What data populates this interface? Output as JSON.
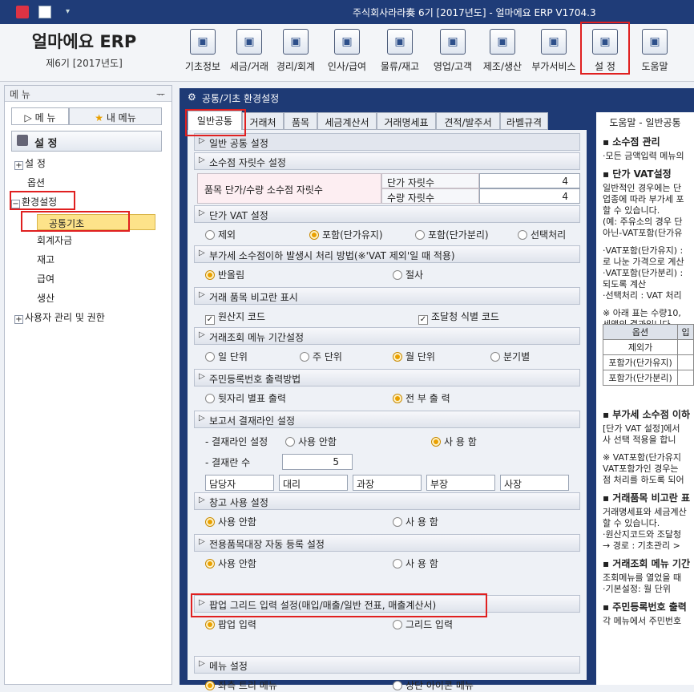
{
  "window": {
    "title": "주식회사라라奏 6기 [2017년도] - 얼마에요 ERP V1704.3"
  },
  "brand": {
    "logo": "얼마에요 ERP",
    "period": "제6기 [2017년도]"
  },
  "toolbar": [
    {
      "label": "기초정보",
      "icon": "doc-icon"
    },
    {
      "label": "세금/거래",
      "icon": "tax-icon"
    },
    {
      "label": "경리/회계",
      "icon": "accounting-icon"
    },
    {
      "label": "인사/급여",
      "icon": "hr-icon"
    },
    {
      "label": "물류/재고",
      "icon": "logistics-icon"
    },
    {
      "label": "영업/고객",
      "icon": "sales-icon"
    },
    {
      "label": "제조/생산",
      "icon": "factory-icon"
    },
    {
      "label": "부가서비스",
      "icon": "addon-icon"
    },
    {
      "label": "설 정",
      "icon": "settings-icon"
    },
    {
      "label": "도움말",
      "icon": "help-icon"
    }
  ],
  "left": {
    "header": "메 뉴",
    "pin": "ᅲ",
    "tab_menu": "메 뉴",
    "tab_my": "내 메뉴",
    "section": "설 정",
    "tree": [
      {
        "label": "설 정",
        "toggle": "+"
      },
      {
        "label": "옵션",
        "toggle": ""
      },
      {
        "label": "환경설정",
        "toggle": "−"
      },
      {
        "label": "공통기초",
        "toggle": ""
      },
      {
        "label": "회계자금",
        "toggle": ""
      },
      {
        "label": "재고",
        "toggle": ""
      },
      {
        "label": "급여",
        "toggle": ""
      },
      {
        "label": "생산",
        "toggle": ""
      },
      {
        "label": "사용자 관리 및 권한",
        "toggle": "+"
      }
    ]
  },
  "main": {
    "title": "공통/기초 환경설정",
    "tabs": [
      "일반공통",
      "거래처",
      "품목",
      "세금계산서",
      "거래명세표",
      "견적/발주서",
      "라벨규격"
    ],
    "help_tab": "도움말 - 일반공통",
    "section_title": "일반 공통 설정"
  },
  "form": {
    "decimal": {
      "title": "소수점 자릿수 설정",
      "label": "품목 단가/수량 소수점 자릿수",
      "unit_label": "단가 자릿수",
      "unit_value": "4",
      "qty_label": "수량 자릿수",
      "qty_value": "4"
    },
    "vat": {
      "title": "단가 VAT 설정",
      "options": [
        "제외",
        "포함(단가유지)",
        "포함(단가분리)",
        "선택처리"
      ],
      "selected": 1
    },
    "round": {
      "title": "부가세 소수점이하 발생시 처리 방법(※'VAT 제외'일 때 적용)",
      "options": [
        "반올림",
        "절사"
      ],
      "selected": 0
    },
    "compare": {
      "title": "거래 품목 비고란 표시",
      "options": [
        "원산지 코드",
        "조달청 식별 코드"
      ]
    },
    "period": {
      "title": "거래조회 메뉴 기간설정",
      "options": [
        "일 단위",
        "주 단위",
        "월 단위",
        "분기별"
      ],
      "selected": 2
    },
    "rrn": {
      "title": "주민등록번호 출력방법",
      "options": [
        "뒷자리 별표 출력",
        "전 부  출 력"
      ],
      "selected": 1
    },
    "approval": {
      "title": "보고서 결재라인 설정",
      "line_label": "-  결재라인 설정",
      "line_options": [
        "사용 안함",
        "사 용 함"
      ],
      "line_selected": 1,
      "count_label": "-  결재란 수",
      "count_value": "5",
      "names": [
        "담당자",
        "대리",
        "과장",
        "부장",
        "사장"
      ]
    },
    "warehouse": {
      "title": "창고 사용 설정",
      "options": [
        "사용 안함",
        "사 용 함"
      ],
      "selected": 0
    },
    "autoreg": {
      "title": "전용품목대장 자동 등록 설정",
      "options": [
        "사용 안함",
        "사 용 함"
      ],
      "selected": 0
    },
    "popup": {
      "title": "팝업 그리드 입력 설정(매입/매출/일반 전표, 매출계산서)",
      "options": [
        "팝업 입력",
        "그리드 입력"
      ],
      "selected": 0
    },
    "menu": {
      "title": "메뉴 설정",
      "options": [
        "좌측 트리 메뉴",
        "상단 아이콘 메뉴"
      ],
      "selected": 0
    }
  },
  "help": {
    "lines": [
      "▪ 소수점 관리",
      "·모든 금액입력 메뉴의",
      "▪ 단가 VAT설정",
      "일반적인 경우에는 단",
      "업종에 따라 부가세 포",
      "할 수 있습니다.",
      "(예: 주유소의 경우 단",
      "아닌-VAT포함(단가유",
      "·VAT포함(단가유지) :",
      "로 나눈 가격으로 계산",
      "·VAT포함(단가분리) :",
      "되도록 계산",
      "·선택처리 : VAT 처리",
      "※ 아래 표는 수량10,",
      "세액의 결과입니다.",
      "▪ 부가세 소수점 이하",
      "[단가 VAT 설정]에서",
      "사 선택 적용을 합니",
      "※ VAT포함(단가유지",
      "VAT포함가인 경우는",
      "점 처리를 하도록 되어",
      "▪ 거래품목 비고란 표",
      "거래명세표와 세금계산",
      "할 수 있습니다.",
      "·원산지코드와 조달청",
      "→ 경로 : 기초관리 >",
      "▪ 거래조회 메뉴 기간",
      "조회메뉴를 열었을 때",
      "·기본설정: 월 단위",
      "▪ 주민등록번호 출력",
      "각 메뉴에서 주민번호"
    ],
    "table": [
      [
        "옵션",
        "입"
      ],
      [
        "제외가",
        ""
      ],
      [
        "포함가(단가유지)",
        ""
      ],
      [
        "포함가(단가분리)",
        ""
      ]
    ]
  }
}
